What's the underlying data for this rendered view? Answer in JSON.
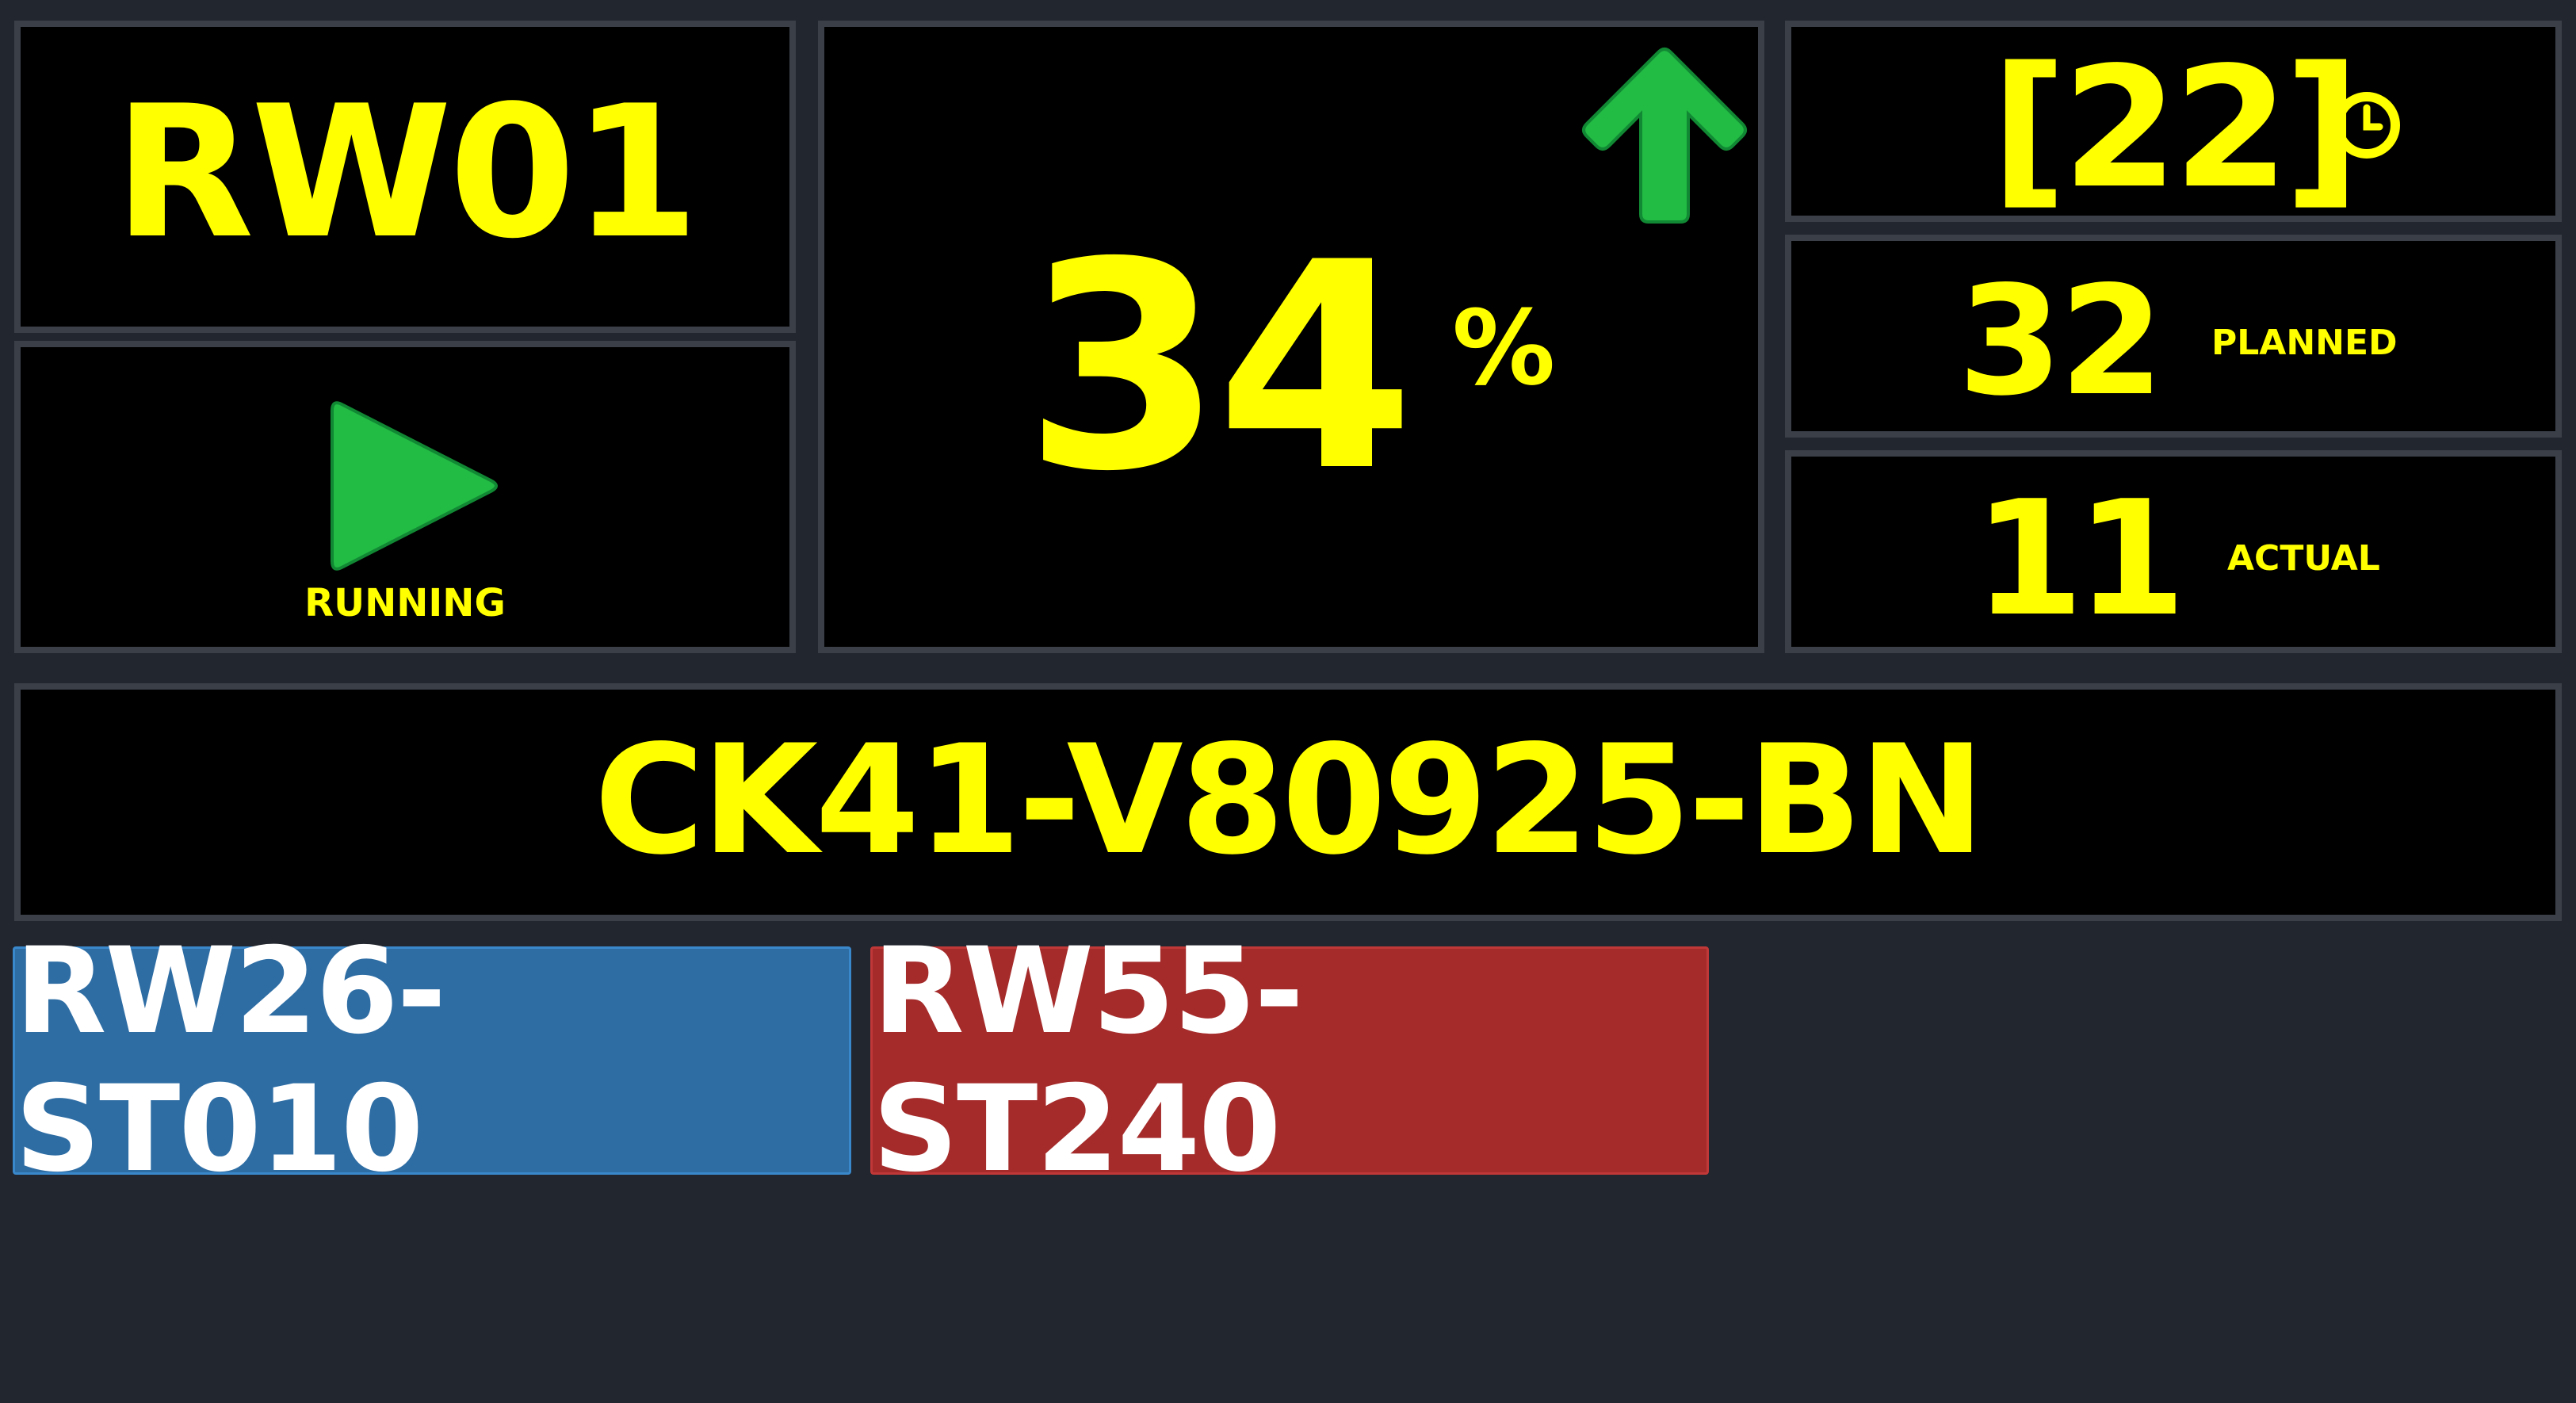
{
  "station": {
    "code": "RW01"
  },
  "status": {
    "label": "RUNNING",
    "icon": "play-icon",
    "color": "#22bb44"
  },
  "efficiency": {
    "value": "34",
    "unit": "%",
    "trend_icon": "arrow-up-icon",
    "trend_color": "#22bb44"
  },
  "cycle": {
    "value": "[22]",
    "icon": "clock-icon"
  },
  "planned": {
    "value": "32",
    "label": "PLANNED"
  },
  "actual": {
    "value": "11",
    "label": "ACTUAL"
  },
  "part_number": "CK41-V80925-BN",
  "stations": [
    {
      "label": "RW26-ST010",
      "color": "#2e6da4"
    },
    {
      "label": "RW55-ST240",
      "color": "#a52a2a"
    }
  ]
}
